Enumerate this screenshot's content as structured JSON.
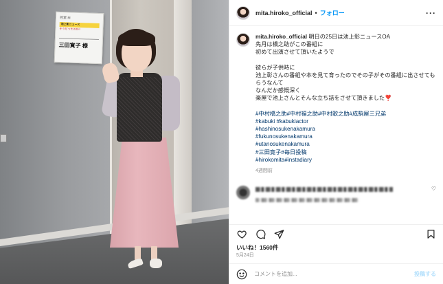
{
  "photo": {
    "sign_room": "控室 M",
    "sign_show": "池上彰ニュース",
    "sign_show_sub": "そうだったのか!!",
    "sign_name": "三田寛子 様"
  },
  "header": {
    "username": "mita.hiroko_official",
    "separator": "•",
    "follow_label": "フォロー",
    "more_label": "···"
  },
  "caption": {
    "username": "mita.hiroko_official",
    "lines": [
      "明日の25日は池上彰ニュースOA",
      "先月は橋之助がこの番組に",
      "初めて出演させて頂いたようで",
      "",
      "彼らが子供時に",
      "池上彰さんの番組や本を見て育ったのでその子がその番組に出させてもらうなんて",
      "なんだか感慨深く",
      "楽屋で池上さんとそんな立ち話をさせて頂きました❣️"
    ],
    "hashtags": [
      "#中村橋之助#中村福之助#中村歌之助#成駒屋三兄弟",
      "#kabuki #kabukiactor",
      "#hashinosukenakamura",
      "#fukunosukenakamura",
      "#utanosukenakamura",
      "#三田寛子#毎日投稿",
      "#hirokomita#instadiary"
    ],
    "time_ago": "4週間前"
  },
  "comment": {
    "heart": "♡"
  },
  "actions": {
    "like_icon": "heart-icon",
    "comment_icon": "comment-icon",
    "share_icon": "share-icon",
    "save_icon": "bookmark-icon"
  },
  "likes_text": "いいね！1560件",
  "date_text": "5月24日",
  "comment_box": {
    "placeholder": "コメントを追加...",
    "post_label": "投稿する"
  },
  "colors": {
    "link_blue": "#0095f6",
    "hashtag": "#00376b",
    "muted": "#8e8e8e"
  }
}
